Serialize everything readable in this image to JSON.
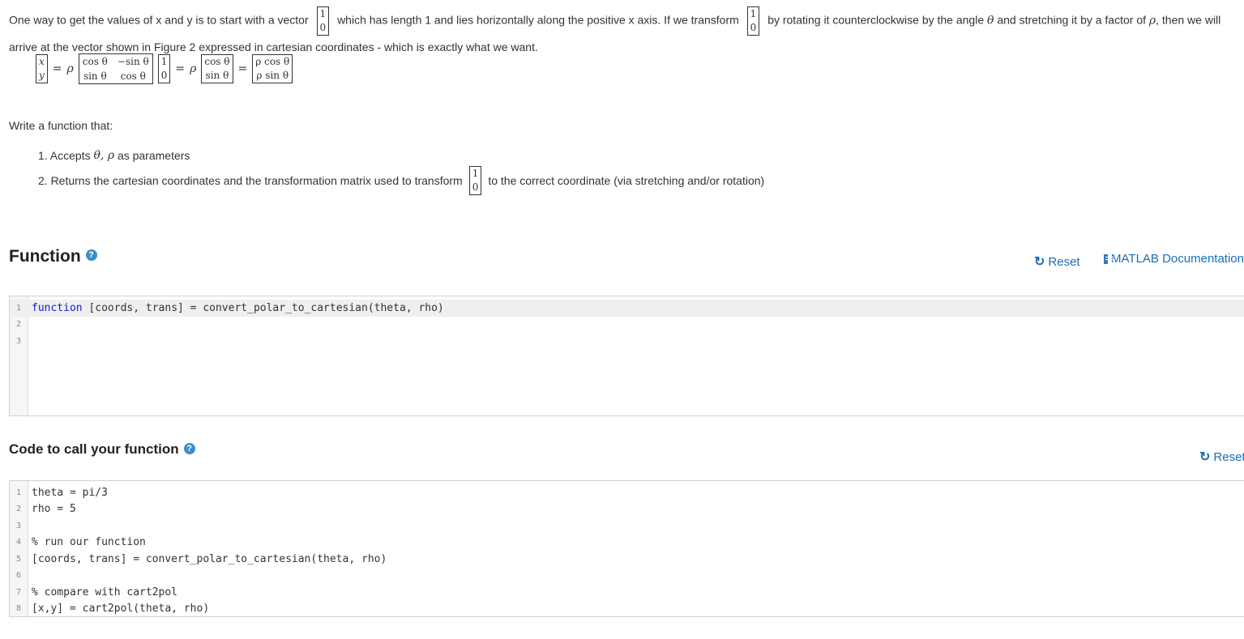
{
  "intro": {
    "s1": "One way to get the values of x and y is to start with a vector",
    "s2": "which has length 1 and lies horizontally along the positive x axis. If we transform",
    "s3": "by rotating it counterclockwise by the angle",
    "theta": "θ",
    "s4": "and stretching it by a factor of",
    "rho": "ρ",
    "s5": ", then we will",
    "s6": "arrive at the vector shown in Figure 2 expressed in cartesian coordinates - which is exactly what we want."
  },
  "vector": {
    "top": "1",
    "bottom": "0"
  },
  "equation": {
    "lhs": [
      "x",
      "y"
    ],
    "eq": "=",
    "rho": "ρ",
    "matrix": [
      "cos θ",
      "−sin θ",
      "sin θ",
      "cos θ"
    ],
    "v2": [
      "cos θ",
      "sin θ"
    ],
    "v3": [
      "ρ cos θ",
      "ρ sin θ"
    ]
  },
  "task": {
    "intro": "Write a function that:",
    "item1_prefix": "1. Accepts",
    "item1_math": "θ, ρ",
    "item1_suffix": "as parameters",
    "item2_prefix": "2. Returns the cartesian coordinates and the transformation matrix used to transform",
    "item2_suffix": "to the correct coordinate (via stretching and/or rotation)"
  },
  "function_section": {
    "title": "Function",
    "help": "?",
    "reset_label": "Reset",
    "docs_label": "MATLAB Documentation",
    "lines": [
      {
        "n": "1",
        "kw": "function",
        "text": " [coords, trans] = convert_polar_to_cartesian(theta, rho)"
      },
      {
        "n": "2",
        "kw": "",
        "text": ""
      },
      {
        "n": "3",
        "kw": "",
        "text": ""
      }
    ]
  },
  "call_section": {
    "title": "Code to call your function",
    "help": "?",
    "reset_label": "Reset",
    "lines": [
      {
        "n": "1",
        "text": "theta = pi/3"
      },
      {
        "n": "2",
        "text": "rho = 5"
      },
      {
        "n": "3",
        "text": ""
      },
      {
        "n": "4",
        "comment": "% run our function"
      },
      {
        "n": "5",
        "text": "[coords, trans] = convert_polar_to_cartesian(theta, rho)"
      },
      {
        "n": "6",
        "text": ""
      },
      {
        "n": "7",
        "comment": "% compare with cart2pol"
      },
      {
        "n": "8",
        "text": "[x,y] = cart2pol(theta, rho)"
      }
    ]
  },
  "colors": {
    "link": "#1a6fb5",
    "help": "#3a8dc9",
    "keyword": "#1020d0",
    "comment": "#228822"
  }
}
